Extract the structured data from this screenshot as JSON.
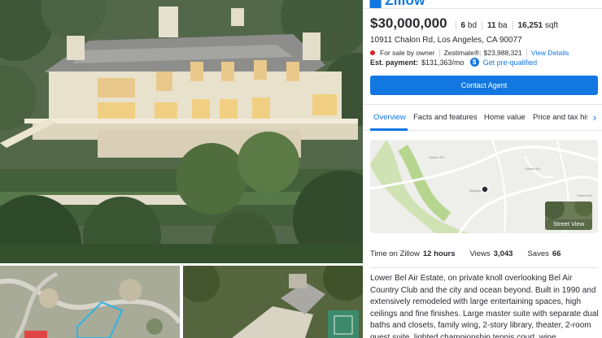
{
  "listing": {
    "price": "$30,000,000",
    "beds_value": "6",
    "beds_unit": "bd",
    "baths_value": "11",
    "baths_unit": "ba",
    "sqft_value": "16,251",
    "sqft_unit": "sqft",
    "address": "10911 Chalon Rd, Los Angeles, CA 90077",
    "status": "For sale by owner",
    "zestimate_label": "Zestimate®:",
    "zestimate_value": "$23,988,321",
    "view_details": "View Details",
    "est_payment_label": "Est. payment:",
    "est_payment_value": "$131,363/mo",
    "prequal_link": "Get pre-qualified",
    "contact_button": "Contact Agent"
  },
  "tabs": [
    "Overview",
    "Facts and features",
    "Home value",
    "Price and tax history"
  ],
  "active_tab_index": 0,
  "map": {
    "street_view_label": "Street View",
    "road_labels": [
      "Chalon Rd",
      "Bellagio Rd",
      "Chalon Rd",
      "Chalon Rd"
    ]
  },
  "stats": {
    "time_label": "Time on Zillow",
    "time_value": "12 hours",
    "views_label": "Views",
    "views_value": "3,043",
    "saves_label": "Saves",
    "saves_value": "66"
  },
  "description": "Lower Bel Air Estate, on private knoll overlooking Bel Air Country Club and the city and ocean beyond. Built in 1990 and extensively remodeled with large entertaining spaces, high ceilings and fine finishes. Large master suite with separate dual baths and closets, family wing, 2-story library, theater, 2-room guest suite, lighted championship tennis court, wine",
  "colors": {
    "accent": "#1277e1",
    "status_dot": "#d92228",
    "text": "#2a2a33"
  },
  "icons": [
    "dollar-icon",
    "chevron-right-icon",
    "status-dot-icon",
    "map-pin-icon"
  ]
}
